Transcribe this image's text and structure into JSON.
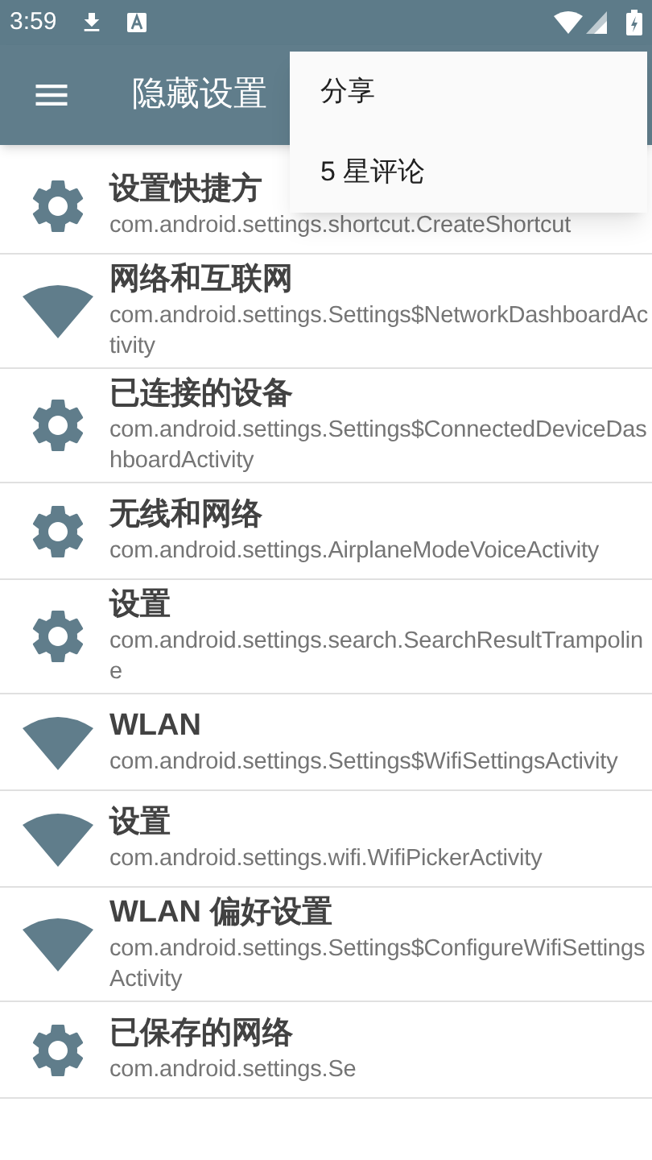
{
  "status_bar": {
    "time": "3:59"
  },
  "toolbar": {
    "title": "隐藏设置"
  },
  "overflow_menu": [
    {
      "label": "分享"
    },
    {
      "label": "5 星评论"
    }
  ],
  "items": [
    {
      "kind": "gear",
      "title": "设置快捷方",
      "subtitle": "com.android.settings.shortcut.CreateShortcut"
    },
    {
      "kind": "wifi",
      "title": "网络和互联网",
      "subtitle": "com.android.settings.Settings$NetworkDashboardActivity"
    },
    {
      "kind": "gear",
      "title": "已连接的设备",
      "subtitle": "com.android.settings.Settings$ConnectedDeviceDashboardActivity"
    },
    {
      "kind": "gear",
      "title": "无线和网络",
      "subtitle": "com.android.settings.AirplaneModeVoiceActivity"
    },
    {
      "kind": "gear",
      "title": "设置",
      "subtitle": "com.android.settings.search.SearchResultTrampoline"
    },
    {
      "kind": "wifi",
      "title": "WLAN",
      "subtitle": "com.android.settings.Settings$WifiSettingsActivity"
    },
    {
      "kind": "wifi",
      "title": "设置",
      "subtitle": "com.android.settings.wifi.WifiPickerActivity"
    },
    {
      "kind": "wifi",
      "title": "WLAN 偏好设置",
      "subtitle": "com.android.settings.Settings$ConfigureWifiSettingsActivity"
    },
    {
      "kind": "gear",
      "title": "已保存的网络",
      "subtitle": "com.android.settings.Se"
    }
  ]
}
